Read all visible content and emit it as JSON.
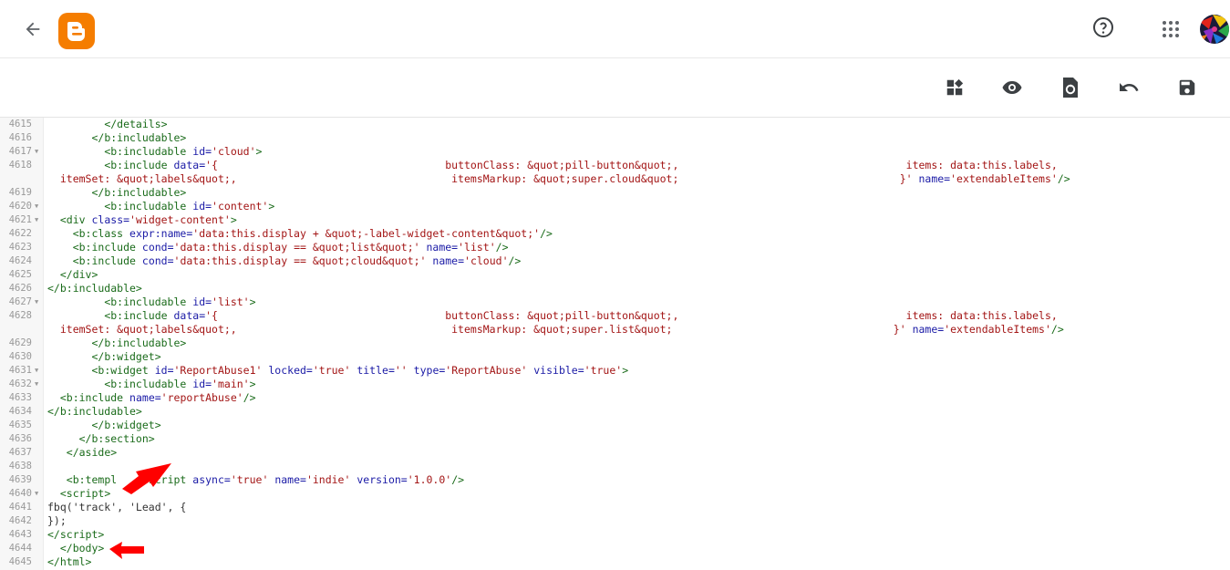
{
  "header": {
    "icons": {
      "back": "arrow-back-icon",
      "logo": "blogger-logo",
      "help": "help-circle-icon",
      "apps": "apps-grid-icon",
      "avatar": "user-avatar"
    },
    "accent_color": "#f57d00"
  },
  "toolbar": {
    "icons": [
      "widget-jump-icon",
      "preview-eye-icon",
      "restore-icon",
      "undo-icon",
      "save-icon"
    ]
  },
  "editor": {
    "lines": [
      {
        "n": "4615",
        "fold": false,
        "indent": "         ",
        "html": "<span class='tag'>&lt;/details&gt;</span>"
      },
      {
        "n": "4616",
        "fold": false,
        "indent": "       ",
        "html": "<span class='tag'>&lt;/b:includable&gt;</span>"
      },
      {
        "n": "4617",
        "fold": true,
        "indent": "         ",
        "html": "<span class='tag'>&lt;b:includable</span> <span class='attr'>id=</span><span class='str'>'cloud'</span><span class='tag'>&gt;</span>"
      },
      {
        "n": "4618",
        "fold": false,
        "indent": "         ",
        "html": "<span class='tag'>&lt;b:include</span> <span class='attr'>data=</span><span class='str'>'{                                    buttonClass: &amp;quot;pill-button&amp;quot;,                                    items: data:this.labels,</span>"
      },
      {
        "n": "",
        "fold": false,
        "indent": "  ",
        "html": "<span class='str'>itemSet: &amp;quot;labels&amp;quot;,                                  itemsMarkup: &amp;quot;super.cloud&amp;quot;                                   }'</span> <span class='attr'>name=</span><span class='str'>'extendableItems'</span><span class='tag'>/&gt;</span>"
      },
      {
        "n": "4619",
        "fold": false,
        "indent": "       ",
        "html": "<span class='tag'>&lt;/b:includable&gt;</span>"
      },
      {
        "n": "4620",
        "fold": true,
        "indent": "         ",
        "html": "<span class='tag'>&lt;b:includable</span> <span class='attr'>id=</span><span class='str'>'content'</span><span class='tag'>&gt;</span>"
      },
      {
        "n": "4621",
        "fold": true,
        "indent": "  ",
        "html": "<span class='tag'>&lt;div</span> <span class='attr'>class=</span><span class='str'>'widget-content'</span><span class='tag'>&gt;</span>"
      },
      {
        "n": "4622",
        "fold": false,
        "indent": "    ",
        "html": "<span class='tag'>&lt;b:class</span> <span class='attr'>expr:name=</span><span class='str'>'data:this.display + &amp;quot;-label-widget-content&amp;quot;'</span><span class='tag'>/&gt;</span>"
      },
      {
        "n": "4623",
        "fold": false,
        "indent": "    ",
        "html": "<span class='tag'>&lt;b:include</span> <span class='attr'>cond=</span><span class='str'>'data:this.display == &amp;quot;list&amp;quot;'</span> <span class='attr'>name=</span><span class='str'>'list'</span><span class='tag'>/&gt;</span>"
      },
      {
        "n": "4624",
        "fold": false,
        "indent": "    ",
        "html": "<span class='tag'>&lt;b:include</span> <span class='attr'>cond=</span><span class='str'>'data:this.display == &amp;quot;cloud&amp;quot;'</span> <span class='attr'>name=</span><span class='str'>'cloud'</span><span class='tag'>/&gt;</span>"
      },
      {
        "n": "4625",
        "fold": false,
        "indent": "  ",
        "html": "<span class='tag'>&lt;/div&gt;</span>"
      },
      {
        "n": "4626",
        "fold": false,
        "indent": "",
        "html": "<span class='tag'>&lt;/b:includable&gt;</span>"
      },
      {
        "n": "4627",
        "fold": true,
        "indent": "         ",
        "html": "<span class='tag'>&lt;b:includable</span> <span class='attr'>id=</span><span class='str'>'list'</span><span class='tag'>&gt;</span>"
      },
      {
        "n": "4628",
        "fold": false,
        "indent": "         ",
        "html": "<span class='tag'>&lt;b:include</span> <span class='attr'>data=</span><span class='str'>'{                                    buttonClass: &amp;quot;pill-button&amp;quot;,                                    items: data:this.labels,</span>"
      },
      {
        "n": "",
        "fold": false,
        "indent": "  ",
        "html": "<span class='str'>itemSet: &amp;quot;labels&amp;quot;,                                  itemsMarkup: &amp;quot;super.list&amp;quot;                                   }'</span> <span class='attr'>name=</span><span class='str'>'extendableItems'</span><span class='tag'>/&gt;</span>"
      },
      {
        "n": "4629",
        "fold": false,
        "indent": "       ",
        "html": "<span class='tag'>&lt;/b:includable&gt;</span>"
      },
      {
        "n": "4630",
        "fold": false,
        "indent": "       ",
        "html": "<span class='tag'>&lt;/b:widget&gt;</span>"
      },
      {
        "n": "4631",
        "fold": true,
        "indent": "       ",
        "html": "<span class='tag'>&lt;b:widget</span> <span class='attr'>id=</span><span class='str'>'ReportAbuse1'</span> <span class='attr'>locked=</span><span class='str'>'true'</span> <span class='attr'>title=</span><span class='str'>''</span> <span class='attr'>type=</span><span class='str'>'ReportAbuse'</span> <span class='attr'>visible=</span><span class='str'>'true'</span><span class='tag'>&gt;</span>"
      },
      {
        "n": "4632",
        "fold": true,
        "indent": "         ",
        "html": "<span class='tag'>&lt;b:includable</span> <span class='attr'>id=</span><span class='str'>'main'</span><span class='tag'>&gt;</span>"
      },
      {
        "n": "4633",
        "fold": false,
        "indent": "  ",
        "html": "<span class='tag'>&lt;b:include</span> <span class='attr'>name=</span><span class='str'>'reportAbuse'</span><span class='tag'>/&gt;</span>"
      },
      {
        "n": "4634",
        "fold": false,
        "indent": "",
        "html": "<span class='tag'>&lt;/b:includable&gt;</span>"
      },
      {
        "n": "4635",
        "fold": false,
        "indent": "       ",
        "html": "<span class='tag'>&lt;/b:widget&gt;</span>"
      },
      {
        "n": "4636",
        "fold": false,
        "indent": "     ",
        "html": "<span class='tag'>&lt;/b:section&gt;</span>"
      },
      {
        "n": "4637",
        "fold": false,
        "indent": "   ",
        "html": "<span class='tag'>&lt;/aside&gt;</span>"
      },
      {
        "n": "4638",
        "fold": false,
        "indent": "",
        "html": ""
      },
      {
        "n": "4639",
        "fold": false,
        "indent": "   ",
        "html": "<span class='tag'>&lt;b:templ</span>     <span class='tag'>script</span> <span class='attr'>async=</span><span class='str'>'true'</span> <span class='attr'>name=</span><span class='str'>'indie'</span> <span class='attr'>version=</span><span class='str'>'1.0.0'</span><span class='tag'>/&gt;</span>"
      },
      {
        "n": "4640",
        "fold": true,
        "indent": "  ",
        "html": "<span class='tag'>&lt;script&gt;</span>"
      },
      {
        "n": "4641",
        "fold": false,
        "indent": "",
        "html": "fbq('track', 'Lead', {"
      },
      {
        "n": "4642",
        "fold": false,
        "indent": "",
        "html": "});"
      },
      {
        "n": "4643",
        "fold": false,
        "indent": "",
        "html": "<span class='tag'>&lt;/script&gt;</span>"
      },
      {
        "n": "4644",
        "fold": false,
        "indent": "  ",
        "html": "<span class='tag'>&lt;/body&gt;</span>"
      },
      {
        "n": "4645",
        "fold": false,
        "indent": "",
        "html": "<span class='tag'>&lt;/html&gt;</span>"
      }
    ]
  },
  "annotations": {
    "arrow_color": "#ff0000"
  }
}
